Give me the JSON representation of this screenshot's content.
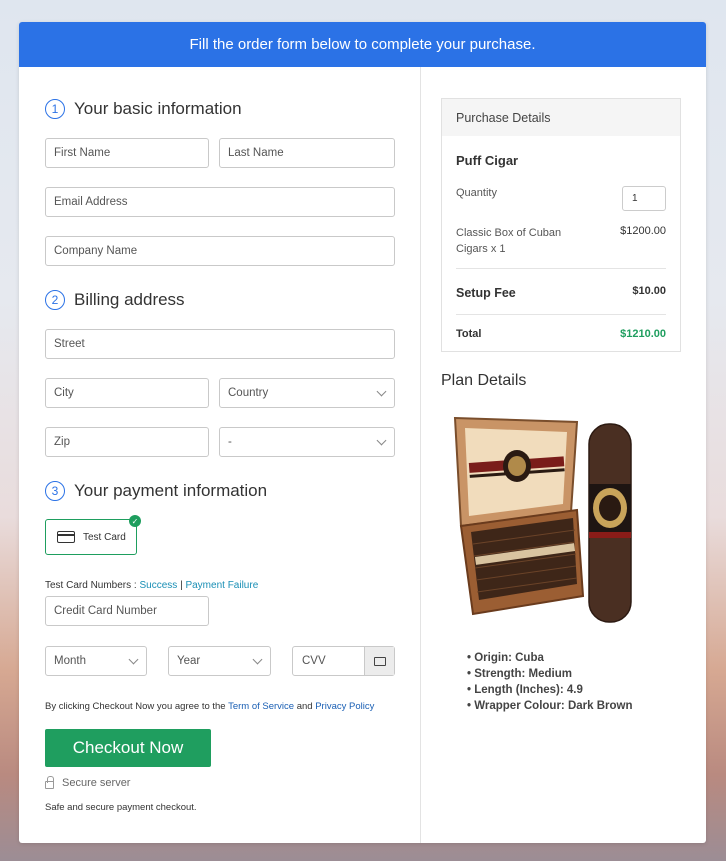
{
  "banner": "Fill the order form below to complete your purchase.",
  "sections": {
    "basic": {
      "num": "1",
      "title": "Your basic information"
    },
    "billing": {
      "num": "2",
      "title": "Billing address"
    },
    "payment": {
      "num": "3",
      "title": "Your payment information"
    }
  },
  "fields": {
    "first_name": "First Name",
    "last_name": "Last Name",
    "email": "Email Address",
    "company": "Company Name",
    "street": "Street",
    "city": "City",
    "country": "Country",
    "zip": "Zip",
    "state": "-",
    "credit_card": "Credit Card Number",
    "month": "Month",
    "year": "Year",
    "cvv": "CVV"
  },
  "payment": {
    "method_label": "Test Card",
    "test_numbers_label": "Test Card Numbers :",
    "success_link": "Success",
    "separator": "|",
    "failure_link": "Payment Failure"
  },
  "agreement": {
    "prefix": "By clicking Checkout Now you agree to the",
    "terms": "Term of Service",
    "and": "and",
    "privacy": "Privacy Policy"
  },
  "checkout_label": "Checkout Now",
  "secure_label": "Secure server",
  "safe_label": "Safe and secure payment checkout.",
  "purchase": {
    "header": "Purchase Details",
    "product": "Puff Cigar",
    "quantity_label": "Quantity",
    "quantity_value": "1",
    "item_label_1": "Classic Box of Cuban",
    "item_label_2": "Cigars x 1",
    "item_price": "$1200.00",
    "setup_label": "Setup Fee",
    "setup_price": "$10.00",
    "total_label": "Total",
    "total_price": "$1210.00"
  },
  "plan": {
    "title": "Plan Details",
    "bullets": [
      "Origin: Cuba",
      "Strength: Medium",
      "Length (Inches): 4.9",
      "Wrapper Colour: Dark Brown"
    ]
  },
  "colors": {
    "accent": "#2b72e6",
    "success": "#1f9e5f",
    "total": "#1f9e5f"
  }
}
